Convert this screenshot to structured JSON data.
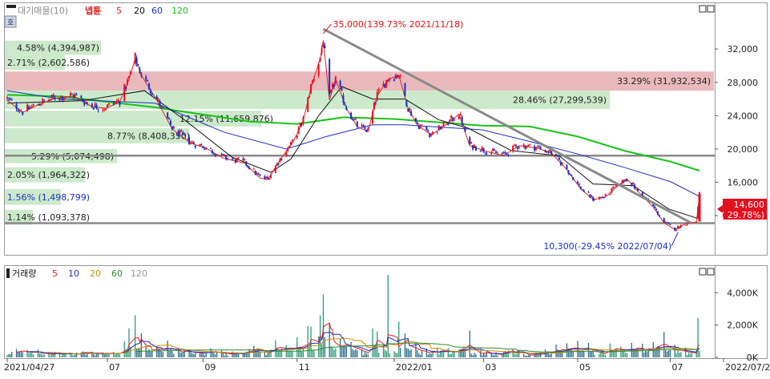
{
  "price_panel": {
    "legend_prefix": "대기매물(10)",
    "stock_name": "넵튠",
    "ma_legend": [
      {
        "label": "5",
        "color": "#e0202a"
      },
      {
        "label": "20",
        "color": "#111111"
      },
      {
        "label": "60",
        "color": "#1a2fc4"
      },
      {
        "label": "120",
        "color": "#19c219"
      }
    ],
    "current_price_label": "14,600",
    "current_change_label": "( 29.78%)",
    "high_annotation": "35,000(139.73% 2021/11/18)",
    "low_annotation": "10,300(-29.45% 2022/07/04)"
  },
  "volume_panel": {
    "legend_prefix": "거래량",
    "ma_legend": [
      {
        "label": "5",
        "color": "#e0202a"
      },
      {
        "label": "10",
        "color": "#1a2fc4"
      },
      {
        "label": "20",
        "color": "#d08a00"
      },
      {
        "label": "60",
        "color": "#2e8b2e"
      },
      {
        "label": "120",
        "color": "#999999"
      }
    ]
  },
  "colors": {
    "up_candle": "#e3101e",
    "down_candle": "#1530c8",
    "supply_green": "#c9e9c8",
    "supply_red": "#e9b5b8",
    "trendline": "#8a8a8a",
    "ma5": "#e0202a",
    "ma20": "#111111",
    "ma60": "#1a2fc4",
    "ma120": "#19c219"
  },
  "chart_data": [
    {
      "type": "candlestick",
      "title": "넵튠",
      "y_tick_labels": [
        "12,000",
        "16,000",
        "20,000",
        "24,000",
        "28,000",
        "32,000"
      ],
      "y_ticks": [
        12000,
        16000,
        20000,
        24000,
        28000,
        32000
      ],
      "ylim": [
        7400,
        37400
      ],
      "x_tick_labels": [
        "2021/04/27",
        "07",
        "09",
        "11",
        "2022/01",
        "03",
        "05",
        "07",
        "2022/07/20"
      ],
      "x_ticks": [
        "2021-04-27",
        "2021-07-01",
        "2021-09-01",
        "2021-11-01",
        "2022-01-03",
        "2022-03-02",
        "2022-05-02",
        "2022-07-01",
        "2022-07-20"
      ],
      "price_path": [
        [
          "2021-04-27",
          26000
        ],
        [
          "2021-05-07",
          24500
        ],
        [
          "2021-05-18",
          25500
        ],
        [
          "2021-05-28",
          26200
        ],
        [
          "2021-06-09",
          26500
        ],
        [
          "2021-06-21",
          25200
        ],
        [
          "2021-06-30",
          25000
        ],
        [
          "2021-07-09",
          25800
        ],
        [
          "2021-07-15",
          28500
        ],
        [
          "2021-07-19",
          31000
        ],
        [
          "2021-07-23",
          29000
        ],
        [
          "2021-08-02",
          26000
        ],
        [
          "2021-08-12",
          22500
        ],
        [
          "2021-08-24",
          20800
        ],
        [
          "2021-09-03",
          20200
        ],
        [
          "2021-09-14",
          19000
        ],
        [
          "2021-09-28",
          18400
        ],
        [
          "2021-10-08",
          16600
        ],
        [
          "2021-10-13",
          16400
        ],
        [
          "2021-10-21",
          18800
        ],
        [
          "2021-10-29",
          20800
        ],
        [
          "2021-11-05",
          23500
        ],
        [
          "2021-11-10",
          27500
        ],
        [
          "2021-11-16",
          31000
        ],
        [
          "2021-11-18",
          33200
        ],
        [
          "2021-11-22",
          26000
        ],
        [
          "2021-11-26",
          28500
        ],
        [
          "2021-12-03",
          25000
        ],
        [
          "2021-12-10",
          22800
        ],
        [
          "2021-12-17",
          22200
        ],
        [
          "2021-12-23",
          26500
        ],
        [
          "2021-12-30",
          28500
        ],
        [
          "2022-01-06",
          29000
        ],
        [
          "2022-01-12",
          25000
        ],
        [
          "2022-01-18",
          23000
        ],
        [
          "2022-01-27",
          21800
        ],
        [
          "2022-02-07",
          23200
        ],
        [
          "2022-02-14",
          24300
        ],
        [
          "2022-02-21",
          20500
        ],
        [
          "2022-03-04",
          19800
        ],
        [
          "2022-03-15",
          19300
        ],
        [
          "2022-03-25",
          20500
        ],
        [
          "2022-04-06",
          20200
        ],
        [
          "2022-04-15",
          19600
        ],
        [
          "2022-04-25",
          17600
        ],
        [
          "2022-05-04",
          15300
        ],
        [
          "2022-05-12",
          14000
        ],
        [
          "2022-05-20",
          14300
        ],
        [
          "2022-05-27",
          15500
        ],
        [
          "2022-06-03",
          16500
        ],
        [
          "2022-06-10",
          15000
        ],
        [
          "2022-06-20",
          13100
        ],
        [
          "2022-06-27",
          11200
        ],
        [
          "2022-07-04",
          10400
        ],
        [
          "2022-07-11",
          11100
        ],
        [
          "2022-07-18",
          11300
        ],
        [
          "2022-07-20",
          14600
        ]
      ],
      "moving_averages": {
        "ma120": [
          [
            "2021-04-27",
            26500
          ],
          [
            "2021-06-01",
            26300
          ],
          [
            "2021-08-01",
            25000
          ],
          [
            "2021-10-01",
            23300
          ],
          [
            "2021-11-01",
            23000
          ],
          [
            "2021-12-01",
            23800
          ],
          [
            "2022-01-03",
            23600
          ],
          [
            "2022-03-01",
            22800
          ],
          [
            "2022-04-01",
            22700
          ],
          [
            "2022-05-02",
            21500
          ],
          [
            "2022-06-01",
            19800
          ],
          [
            "2022-07-01",
            18500
          ],
          [
            "2022-07-20",
            17400
          ]
        ],
        "ma60": [
          [
            "2021-04-27",
            27000
          ],
          [
            "2021-06-01",
            26000
          ],
          [
            "2021-08-01",
            25500
          ],
          [
            "2021-09-15",
            22000
          ],
          [
            "2021-10-25",
            20000
          ],
          [
            "2021-11-20",
            21500
          ],
          [
            "2021-12-20",
            22900
          ],
          [
            "2022-01-10",
            22900
          ],
          [
            "2022-03-01",
            22300
          ],
          [
            "2022-04-01",
            20900
          ],
          [
            "2022-05-02",
            19400
          ],
          [
            "2022-06-01",
            17800
          ],
          [
            "2022-07-01",
            16100
          ],
          [
            "2022-07-20",
            14300
          ]
        ],
        "ma20": [
          [
            "2021-04-27",
            25500
          ],
          [
            "2021-06-15",
            25800
          ],
          [
            "2021-07-25",
            27000
          ],
          [
            "2021-08-20",
            23500
          ],
          [
            "2021-09-20",
            19000
          ],
          [
            "2021-10-15",
            17200
          ],
          [
            "2021-10-28",
            18800
          ],
          [
            "2021-11-15",
            24000
          ],
          [
            "2021-11-30",
            27500
          ],
          [
            "2021-12-20",
            26000
          ],
          [
            "2022-01-10",
            26000
          ],
          [
            "2022-02-01",
            23500
          ],
          [
            "2022-02-20",
            22500
          ],
          [
            "2022-03-20",
            19800
          ],
          [
            "2022-04-20",
            19200
          ],
          [
            "2022-05-12",
            15800
          ],
          [
            "2022-06-07",
            15600
          ],
          [
            "2022-06-30",
            12800
          ],
          [
            "2022-07-20",
            11600
          ]
        ]
      },
      "supply_zones": [
        {
          "label": "4.58% (4,394,987)",
          "price_low": 31300,
          "price_high": 33000,
          "color": "green"
        },
        {
          "label": "2.71% (2,602,586)",
          "price_low": 29500,
          "price_high": 31300,
          "color": "green"
        },
        {
          "label": "33.29% (31,932,534)",
          "price_low": 27000,
          "price_high": 29300,
          "color": "red"
        },
        {
          "label": "28.46% (27,299,539)",
          "price_low": 24800,
          "price_high": 27000,
          "color": "green"
        },
        {
          "label": "12.15% (11,659,876)",
          "price_low": 22700,
          "price_high": 24600,
          "color": "green"
        },
        {
          "label": "8.77% (8,408,350)",
          "price_low": 20700,
          "price_high": 22500,
          "color": "green"
        },
        {
          "label": "5.29% (5,074,498)",
          "price_low": 18300,
          "price_high": 20000,
          "color": "green"
        },
        {
          "label": "2.05% (1,964,322)",
          "price_low": 16000,
          "price_high": 17800,
          "color": "green"
        },
        {
          "label": "1.56% (1,498,799)",
          "price_low": 13300,
          "price_high": 15200,
          "color": "green"
        },
        {
          "label": "1.14% (1,093,378)",
          "price_low": 10900,
          "price_high": 12700,
          "color": "green"
        }
      ],
      "trendline": {
        "from": [
          "2021-11-18",
          34400
        ],
        "to": [
          "2022-07-15",
          11100
        ]
      },
      "horizontal_lines": [
        19200,
        11100
      ],
      "high_point": {
        "date": "2021-11-18",
        "price": 35000
      },
      "low_point": {
        "date": "2022-07-04",
        "price": 10300
      },
      "last": {
        "date": "2022-07-20",
        "price": 14600,
        "change_pct": 29.78
      }
    },
    {
      "type": "bar",
      "title": "거래량",
      "y_tick_labels": [
        "0K",
        "2,000K",
        "4,000K"
      ],
      "y_ticks": [
        0,
        2000000,
        4000000
      ],
      "ylim": [
        0,
        5600000
      ],
      "volume_spikes": [
        [
          "2021-07-15",
          1800000
        ],
        [
          "2021-07-19",
          2600000
        ],
        [
          "2021-07-23",
          1500000
        ],
        [
          "2021-11-10",
          1900000
        ],
        [
          "2021-11-16",
          2600000
        ],
        [
          "2021-11-18",
          3900000
        ],
        [
          "2021-11-22",
          2100000
        ],
        [
          "2021-12-23",
          1600000
        ],
        [
          "2021-12-30",
          5100000
        ],
        [
          "2022-01-06",
          2200000
        ],
        [
          "2022-07-20",
          400000
        ]
      ]
    }
  ]
}
